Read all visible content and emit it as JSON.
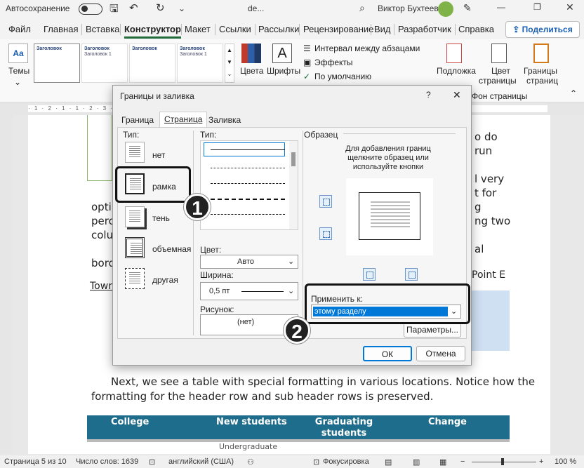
{
  "titlebar": {
    "autosave": "Автосохранение",
    "doc_name": "de...",
    "user": "Виктор Бухтеев"
  },
  "tabs": [
    "Файл",
    "Главная",
    "Вставка",
    "Конструктор",
    "Макет",
    "Ссылки",
    "Рассылки",
    "Рецензирование",
    "Вид",
    "Разработчик",
    "Справка"
  ],
  "share": "Поделиться",
  "ribbon": {
    "themes": "Темы",
    "gallery": [
      {
        "h": "Заголовок",
        "b": ""
      },
      {
        "h": "Заголовок",
        "b": "Заголовок 1"
      },
      {
        "h": "Заголовок",
        "b": ""
      },
      {
        "h": "Заголовок",
        "b": "Заголовок 1"
      }
    ],
    "colors": "Цвета",
    "fonts": "Шрифты",
    "paragraph_spacing": "Интервал между абзацами",
    "effects": "Эффекты",
    "default": "По умолчанию",
    "watermark": "Подложка",
    "page_color_1": "Цвет",
    "page_color_2": "страницы",
    "borders_1": "Границы",
    "borders_2": "страниц",
    "group_label": "Фон страницы"
  },
  "ruler": "· 1 · 2 · 1 · 1 · 2 · 3 · 4 · 5 · 6 · 7 · 8 · 9 · 10 · 11 · 12 · 13 · 14 · 15 · 16 · 17 · 18 ·",
  "doc": {
    "frag1": "o do",
    "frag2": "run",
    "frag3": "l very",
    "frag4": "t for",
    "frag5": "g",
    "frag6": "ng two",
    "frag7": "al",
    "frag8": "Point E",
    "left1": "opti",
    "left2": "perc",
    "left3": "colu",
    "left4": "bord",
    "left5": "Town",
    "para1": "Next, we see a table with special formatting in various locations. Notice how the",
    "para2": "formatting for the header row and sub header rows is preserved.",
    "table_headers": [
      "College",
      "New students",
      "Graduating students",
      "Change"
    ],
    "subrow": "Undergraduate"
  },
  "dialog": {
    "title": "Границы и заливка",
    "help": "?",
    "tabs": [
      "Граница",
      "Страница",
      "Заливка"
    ],
    "type_label": "Тип:",
    "types": [
      "нет",
      "рамка",
      "тень",
      "объемная",
      "другая"
    ],
    "style_label": "Тип:",
    "color_label": "Цвет:",
    "color_value": "Авто",
    "width_label": "Ширина:",
    "width_value": "0,5 пт",
    "art_label": "Рисунок:",
    "art_value": "(нет)",
    "preview_label": "Образец",
    "preview_hint": "Для добавления границ щелкните образец или используйте кнопки",
    "apply_label": "Применить к:",
    "apply_value": "этому разделу",
    "options_btn": "Параметры...",
    "ok": "ОК",
    "cancel": "Отмена"
  },
  "callouts": [
    "1",
    "2"
  ],
  "status": {
    "page": "Страница 5 из 10",
    "words": "Число слов: 1639",
    "lang": "английский (США)",
    "focus": "Фокусировка",
    "zoom": "100 %"
  },
  "colors": {
    "accent": "#1f6b3a",
    "table_header": "#1f6d8c",
    "selection": "#0078d7"
  }
}
